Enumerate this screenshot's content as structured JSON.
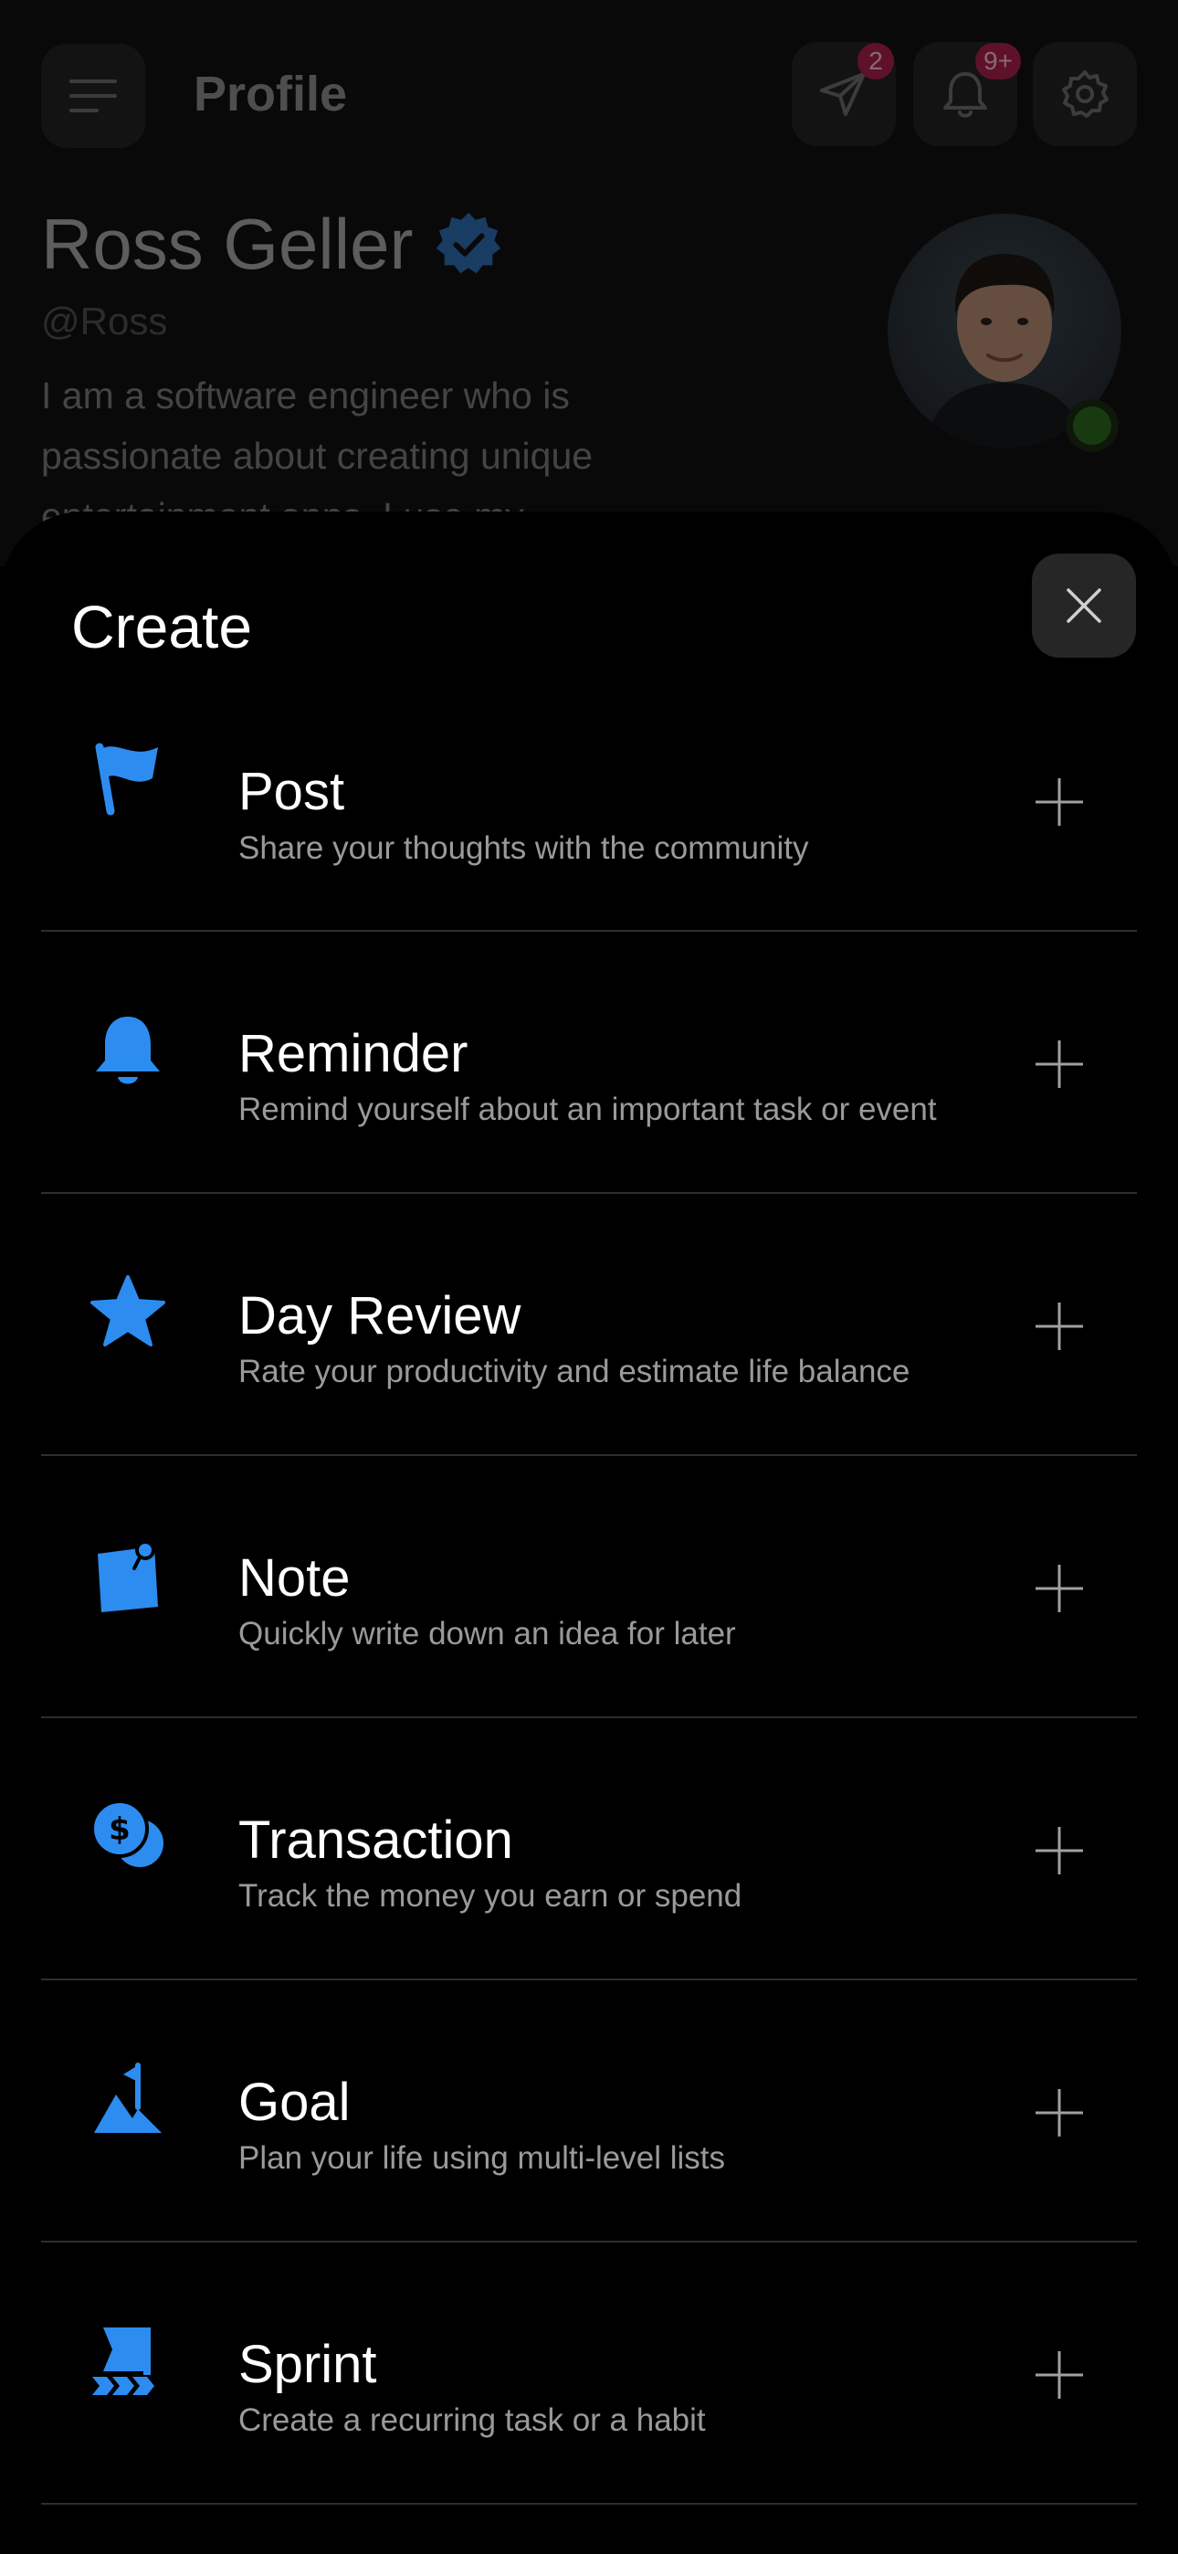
{
  "header": {
    "title": "Profile",
    "messages_badge": "2",
    "notifications_badge": "9+"
  },
  "profile": {
    "name": "Ross Geller",
    "handle": "@Ross",
    "bio": "I am a software engineer who is passionate about creating unique entertainment apps. I use my"
  },
  "sheet": {
    "title": "Create",
    "items": [
      {
        "icon": "flag-icon",
        "title": "Post",
        "description": "Share your thoughts with the community"
      },
      {
        "icon": "bell-icon",
        "title": "Reminder",
        "description": "Remind yourself about an important task or event"
      },
      {
        "icon": "star-icon",
        "title": "Day Review",
        "description": "Rate your productivity and estimate life balance"
      },
      {
        "icon": "note-icon",
        "title": "Note",
        "description": "Quickly write down an idea for later"
      },
      {
        "icon": "coins-icon",
        "title": "Transaction",
        "description": "Track the money you earn or spend"
      },
      {
        "icon": "mountain-flag-icon",
        "title": "Goal",
        "description": "Plan your life using multi-level lists"
      },
      {
        "icon": "sprint-flag-icon",
        "title": "Sprint",
        "description": "Create a recurring task or a habit"
      }
    ]
  },
  "colors": {
    "accent": "#2d8cf0",
    "badge": "#b01f4e",
    "online": "#2d6a1f",
    "verified": "#2e6db4"
  }
}
